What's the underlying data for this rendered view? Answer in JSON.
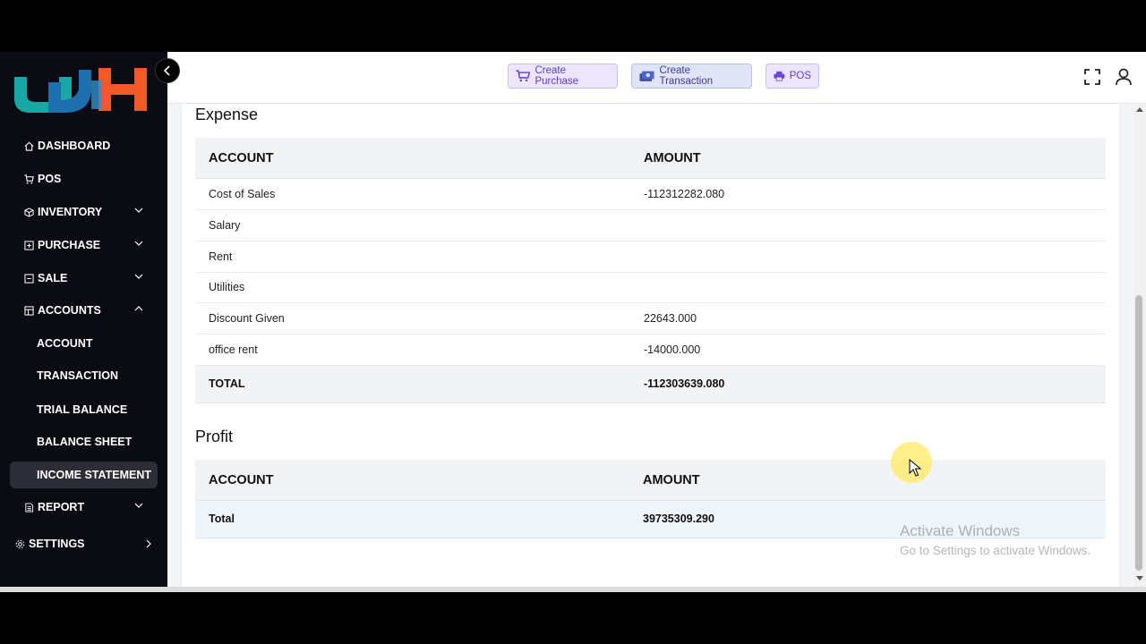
{
  "header": {
    "buttons": {
      "create_purchase": "Create Purchase",
      "create_transaction": "Create Transaction",
      "pos": "POS"
    }
  },
  "sidebar": {
    "items": [
      {
        "label": "DASHBOARD",
        "icon": "home-icon"
      },
      {
        "label": "POS",
        "icon": "cart-icon"
      },
      {
        "label": "INVENTORY",
        "icon": "cube-icon"
      },
      {
        "label": "PURCHASE",
        "icon": "plus-square-icon"
      },
      {
        "label": "SALE",
        "icon": "minus-square-icon"
      },
      {
        "label": "ACCOUNTS",
        "icon": "calculator-icon"
      }
    ],
    "accounts_sub": [
      "ACCOUNT",
      "TRANSACTION",
      "TRIAL BALANCE",
      "BALANCE SHEET",
      "INCOME STATEMENT"
    ],
    "active_sub": "INCOME STATEMENT",
    "report": "REPORT",
    "settings": "SETTINGS"
  },
  "expense": {
    "title": "Expense",
    "columns": [
      "ACCOUNT",
      "AMOUNT"
    ],
    "rows": [
      {
        "account": "Cost of Sales",
        "amount": "-112312282.080"
      },
      {
        "account": "Salary",
        "amount": ""
      },
      {
        "account": "Rent",
        "amount": ""
      },
      {
        "account": "Utilities",
        "amount": ""
      },
      {
        "account": "Discount Given",
        "amount": "22643.000"
      },
      {
        "account": "office rent",
        "amount": "-14000.000"
      }
    ],
    "total": {
      "label": "TOTAL",
      "amount": "-112303639.080"
    }
  },
  "profit": {
    "title": "Profit",
    "columns": [
      "ACCOUNT",
      "AMOUNT"
    ],
    "total": {
      "label": "Total",
      "amount": "39735309.290"
    }
  },
  "watermark": {
    "line1": "Activate Windows",
    "line2": "Go to Settings to activate Windows."
  },
  "colors": {
    "sidebar_bg": "#0b0b14",
    "accent": "#5b3fc6"
  }
}
